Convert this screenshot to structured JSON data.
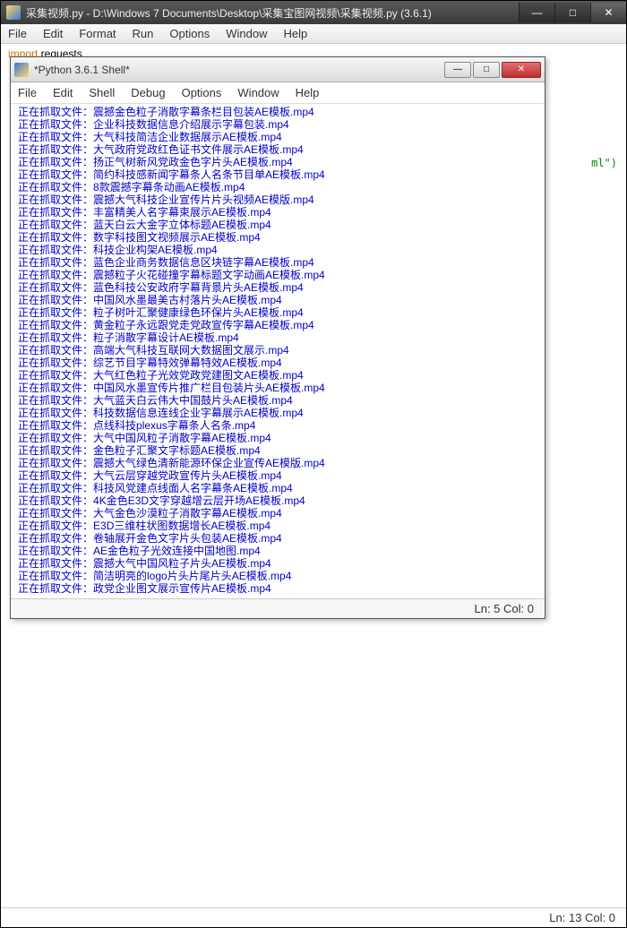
{
  "main": {
    "title": "采集视频.py - D:\\Windows 7 Documents\\Desktop\\采集宝图网视频\\采集视频.py (3.6.1)",
    "menu": [
      "File",
      "Edit",
      "Format",
      "Run",
      "Options",
      "Window",
      "Help"
    ],
    "import_kw": "import",
    "import_mod": " requests",
    "peek": "ml\")",
    "status": "Ln: 13   Col: 0"
  },
  "shell": {
    "title": "*Python 3.6.1 Shell*",
    "menu": [
      "File",
      "Edit",
      "Shell",
      "Debug",
      "Options",
      "Window",
      "Help"
    ],
    "prefix": "正在抓取文件：",
    "lines": [
      "震撼金色粒子消散字幕条栏目包装AE模板.mp4",
      "企业科技数据信息介绍展示字幕包装.mp4",
      "大气科技简洁企业数据展示AE模板.mp4",
      "大气政府党政红色证书文件展示AE模板.mp4",
      "扬正气树新风党政金色字片头AE模板.mp4",
      "简约科技感新闻字幕条人名条节目单AE模板.mp4",
      "8款震撼字幕条动画AE模板.mp4",
      "震撼大气科技企业宣传片片头视频AE模版.mp4",
      "丰富精美人名字幕束展示AE模板.mp4",
      "蓝天白云大金字立体标题AE模板.mp4",
      "数字科技图文视频展示AE模板.mp4",
      "科技企业构架AE模板.mp4",
      "蓝色企业商务数据信息区块链字幕AE模板.mp4",
      "震撼粒子火花碰撞字幕标题文字动画AE模板.mp4",
      "蓝色科技公安政府字幕背景片头AE模板.mp4",
      "中国风水墨最美古村落片头AE模板.mp4",
      "粒子树叶汇聚健康绿色环保片头AE模板.mp4",
      "黄金粒子永远跟党走党政宣传字幕AE模板.mp4",
      "粒子消散字幕设计AE模板.mp4",
      "高端大气科技互联网大数据图文展示.mp4",
      "综艺节目字幕特效弹幕特效AE模板.mp4",
      "大气红色粒子光效党政党建图文AE模板.mp4",
      "中国风水墨宣传片推广栏目包装片头AE模板.mp4",
      "大气蓝天白云伟大中国鼓片头AE模板.mp4",
      "科技数据信息连线企业字幕展示AE模板.mp4",
      "点线科技plexus字幕条人名条.mp4",
      "大气中国风粒子消散字幕AE模板.mp4",
      "金色粒子汇聚文字标题AE模板.mp4",
      "震撼大气绿色清新能源环保企业宣传AE模版.mp4",
      "大气云层穿越党政宣传片头AE模板.mp4",
      "科技风党建点线面人名字幕条AE模板.mp4",
      "4K金色E3D文字穿越增云层开场AE模板.mp4",
      "大气金色沙漠粒子消散字幕AE模板.mp4",
      "E3D三维柱状图数据增长AE模板.mp4",
      "卷轴展开金色文字片头包装AE模板.mp4",
      "AE金色粒子光效连接中国地图.mp4",
      "震撼大气中国风粒子片头AE模板.mp4",
      "简洁明亮的logo片头片尾片头AE模板.mp4",
      "政党企业图文展示宣传片AE模板.mp4"
    ],
    "status": "Ln: 5   Col: 0"
  }
}
